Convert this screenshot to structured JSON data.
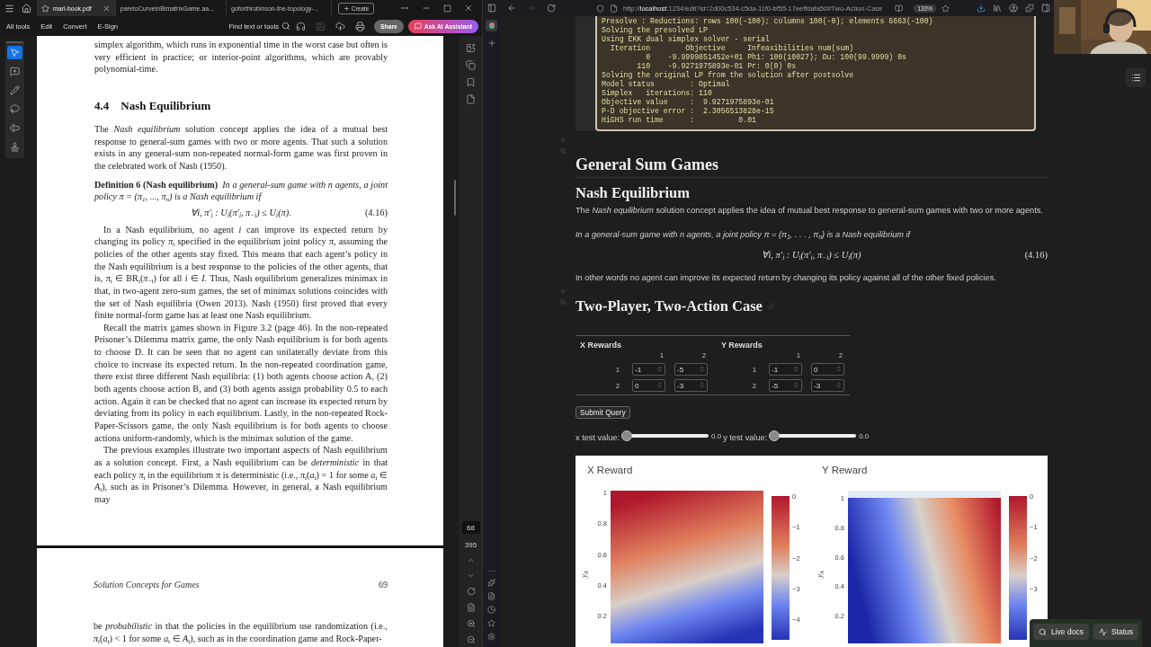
{
  "acrobat": {
    "tabs": [
      {
        "label": "marl-book.pdf",
        "selected": true
      },
      {
        "label": "paretoCurveInBimatrixGame.aa...",
        "selected": false
      },
      {
        "label": "goforthrobinson-the-topology-...",
        "selected": false
      }
    ],
    "create_button": "Create",
    "menu": [
      "All tools",
      "Edit",
      "Convert",
      "E-Sign"
    ],
    "search": {
      "placeholder": "Find text or tools"
    },
    "share_button": "Share",
    "ai_button": "Ask AI Assistant",
    "tools": [
      {
        "kind": "select",
        "selected": true
      },
      {
        "kind": "comment",
        "selected": false
      },
      {
        "kind": "draw",
        "selected": false
      },
      {
        "kind": "lasso",
        "selected": false
      },
      {
        "kind": "text",
        "selected": false
      },
      {
        "kind": "stamp",
        "selected": false
      }
    ],
    "page": {
      "blocks": [
        {
          "kind": "paragraph",
          "indent": false,
          "text": "simplex algorithm, which runs in exponential time in the worst case but often is very efficient in practice; or interior-point algorithms, which are provably polynomial-time."
        },
        {
          "kind": "heading",
          "number": "4.4",
          "text": "Nash Equilibrium"
        },
        {
          "kind": "paragraph",
          "indent": false,
          "text": "The *Nash equilibrium* solution concept applies the idea of a mutual best response to general-sum games with two or more agents. That such a solution exists in any general-sum non-repeated normal-form game was first proven in the celebrated work of Nash (1950)."
        },
        {
          "kind": "definition",
          "label": "Definition 6 (Nash equilibrium)",
          "text": "In a general-sum game with n agents, a joint policy π = (π$_{1}$, ..., π$_{n}$) is a Nash equilibrium if"
        },
        {
          "kind": "equation",
          "text": "∀i, π′$_{i}$ : U$_{i}$(π′$_{i}$, π$_{−i}$) ≤ U$_{i}$(π).",
          "number": "(4.16)"
        },
        {
          "kind": "paragraph",
          "indent": true,
          "text": "In a Nash equilibrium, no agent *i* can improve its expected return by changing its policy *π*$_{i}$ specified in the equilibrium joint policy *π*, assuming the policies of the other agents stay fixed.  This means that each agent’s policy in the Nash equilibrium is a best response to the policies of the other agents, that is, *π*$_{i}$ ∈ BR$_{i}$(*π*$_{−i}$) for all *i* ∈ *I*. Thus, Nash equilibrium generalizes minimax in that, in two-agent zero-sum games, the set of minimax solutions coincides with the set of Nash equilibria (Owen 2013). Nash (1950) first proved that every finite normal-form game has at least one Nash equilibrium."
        },
        {
          "kind": "paragraph",
          "indent": true,
          "text": "Recall the matrix games shown in Figure 3.2 (page 46). In the non-repeated Prisoner’s Dilemma matrix game, the only Nash equilibrium is for both agents to choose D.  It can be seen that no agent can unilaterally deviate from this choice to increase its expected return. In the non-repeated coordination game, there exist three different Nash equilibria: (1) both agents choose action A, (2) both agents choose action B, and (3) both agents assign probability 0.5 to each action. Again it can be checked that no agent can increase its expected return by deviating from its policy in each equilibrium. Lastly, in the non-repeated Rock-Paper-Scissors game, the only Nash equilibrium is for both agents to choose actions uniform-randomly, which is the minimax solution of the game."
        },
        {
          "kind": "paragraph",
          "indent": true,
          "text": "The previous examples illustrate two important aspects of Nash equilibrium as a solution concept. First, a Nash equilibrium can be *deterministic* in that each policy *π*$_{i}$ in the equilibrium *π* is deterministic (i.e., *π*$_{i}$(*a*$_{i}$) = 1 for some *a*$_{i}$ ∈ *A*$_{i}$), such as in Prisoner’s Dilemma. However, in general, a Nash equilibrium may"
        }
      ]
    },
    "next_page": {
      "header": "Solution Concepts for Games",
      "number": "69",
      "blocks": [
        {
          "kind": "paragraph",
          "indent": false,
          "text": "be *probabilistic* in that the policies in the equilibrium use randomization (i.e., *π*$_{i}$(*a*$_{i}$) < 1 for some *a*$_{i}$ ∈ *A*$_{i}$), such as in the coordination game and Rock-Paper-"
        }
      ]
    },
    "page_number": {
      "current": "68",
      "total": "395"
    }
  },
  "browser": {
    "url": "http://**localhost**:1234/edit?id=2d00c534-c5da-11f0-bf55-17eeffdafa50#Two-Action-Case",
    "zoom": "130%"
  },
  "notebook": {
    "console_lines": [
      "Presolve : Reductions: rows 100(-100); columns 100(-0); elements 6663(-100)",
      "Solving the presolved LP",
      "Using EKK dual simplex solver - serial",
      "  Iteration        Objective     Infeasibilities num(sum)",
      "          0    -9.9999851452e+01 Ph1: 100(10027); Du: 100(99.9999) 0s",
      "        110    -9.9271975893e-01 Pr: 0(0) 0s",
      "Solving the original LP from the solution after postsolve",
      "Model status        : Optimal",
      "Simplex   iterations: 110",
      "Objective value     :  9.9271975893e-01",
      "P-D objective error :  2.3056513828e-15",
      "HiGHS run time      :          0.01"
    ],
    "title": "General Sum Games",
    "subtitle": "Nash Equilibrium",
    "intro": "The *Nash equilibrium* solution concept applies the idea of mutual best response to general-sum games with two or more agents.",
    "definition": "In a general-sum game with n agents, a joint policy π = (π$_{1}$, . . . , π$_{n}$) is a Nash equilibrium if",
    "equation": {
      "text": "∀i, π′$_{i}$ : U$_{i}$(π′$_{i}$, π$_{−i}$) ≤ U$_{i}$(π)",
      "number": "(4.16)"
    },
    "remark": "In other words no agent can improve its expected return by changing its policy against all of the other fixed policies.",
    "section": "Two-Player, Two-Action Case",
    "rewards": [
      {
        "title": "X Rewards",
        "col_headers": [
          "1",
          "2"
        ],
        "rows": [
          {
            "label": "1",
            "values": [
              "-1",
              "-5"
            ]
          },
          {
            "label": "2",
            "values": [
              "0",
              "-3"
            ]
          }
        ]
      },
      {
        "title": "Y Rewards",
        "col_headers": [
          "1",
          "2"
        ],
        "rows": [
          {
            "label": "1",
            "values": [
              "-1",
              "0"
            ]
          },
          {
            "label": "2",
            "values": [
              "-5",
              "-3"
            ]
          }
        ]
      }
    ],
    "submit_button": "Submit Query",
    "sliders": [
      {
        "label": "x test value:",
        "level": 0,
        "reading": "0.0"
      },
      {
        "label": "y test value:",
        "level": 0,
        "reading": "0.0"
      }
    ],
    "heatmaps": [
      {
        "kind": "x",
        "title": "X Reward",
        "ylabel": "y$_{A}$",
        "yticks": [
          "1",
          "0.8",
          "0.6",
          "0.4",
          "0.2"
        ],
        "colorbar_ticks": [
          "0",
          "−1",
          "−2",
          "−3",
          "−4"
        ]
      },
      {
        "kind": "y",
        "title": "Y Reward",
        "ylabel": "y$_{A}$",
        "yticks": [
          "1",
          "0.8",
          "0.6",
          "0.4",
          "0.2"
        ],
        "colorbar_ticks": [
          "0",
          "−1",
          "−2",
          "−3"
        ]
      }
    ]
  },
  "footer_buttons": [
    {
      "kind": "docs",
      "label": "Live docs"
    },
    {
      "kind": "status",
      "label": "Status"
    }
  ]
}
